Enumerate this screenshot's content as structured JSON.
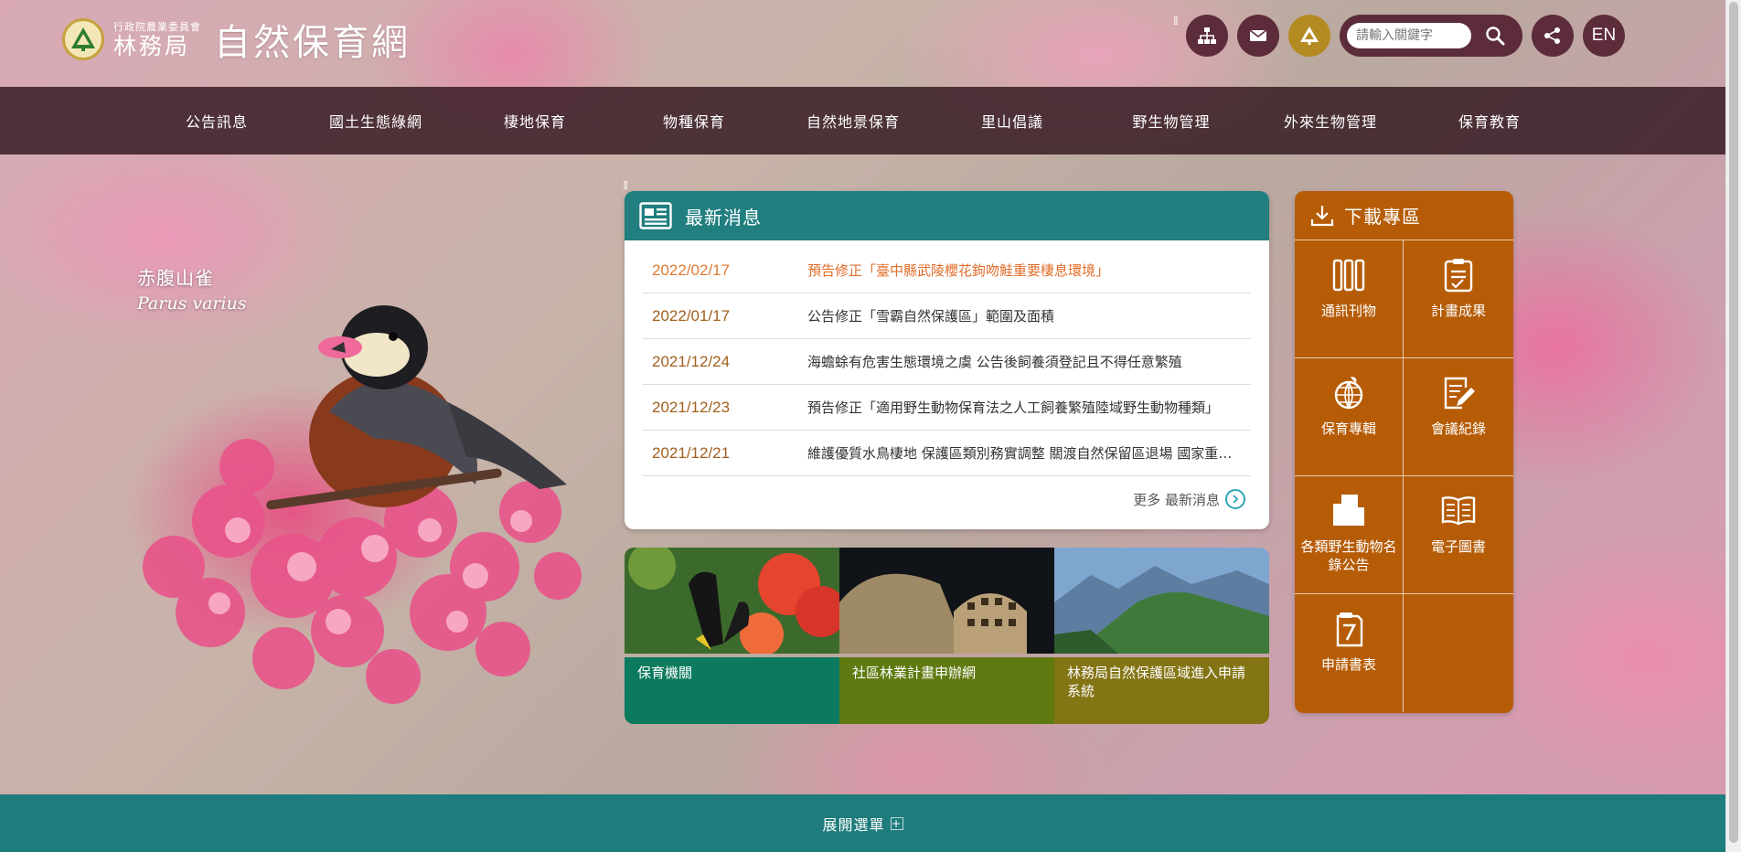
{
  "header": {
    "logo_sub": "行政院農業委員會",
    "logo_main": "林務局",
    "site_title": "自然保育網",
    "search_placeholder": "請輸入關鍵字",
    "lang_label": "EN",
    "tool_handle": "⁞⁞"
  },
  "nav": {
    "items": [
      "公告訊息",
      "國土生態綠網",
      "棲地保育",
      "物種保育",
      "自然地景保育",
      "里山倡議",
      "野生物管理",
      "外來生物管理",
      "保育教育"
    ]
  },
  "species": {
    "name_zh": "赤腹山雀",
    "name_latin": "Parus varius"
  },
  "news": {
    "title": "最新消息",
    "items": [
      {
        "date": "2022/02/17",
        "text": "預告修正「臺中縣武陵櫻花鉤吻鮭重要棲息環境」"
      },
      {
        "date": "2022/01/17",
        "text": "公告修正「雪霸自然保護區」範圍及面積"
      },
      {
        "date": "2021/12/24",
        "text": "海蟾蜍有危害生態環境之虞 公告後飼養須登記且不得任意繁殖"
      },
      {
        "date": "2021/12/23",
        "text": "預告修正「適用野生動物保育法之人工飼養繁殖陸域野生動物種類」"
      },
      {
        "date": "2021/12/21",
        "text": "維護優質水鳥棲地 保護區類別務實調整 關渡自然保留區退場 國家重要濕地"
      }
    ],
    "more_label": "更多 最新消息"
  },
  "tiles": [
    {
      "label": "保育機關"
    },
    {
      "label": "社區林業計畫申辦網"
    },
    {
      "label": "林務局自然保護區域進入申請系統"
    }
  ],
  "downloads": {
    "title": "下載專區",
    "items": [
      {
        "label": "通訊刊物",
        "icon": "books-icon"
      },
      {
        "label": "計畫成果",
        "icon": "clipboard-icon"
      },
      {
        "label": "保育專輯",
        "icon": "globe-icon"
      },
      {
        "label": "會議紀錄",
        "icon": "edit-document-icon"
      },
      {
        "label": "各類野生動物名錄公告",
        "icon": "folder-icon"
      },
      {
        "label": "電子圖書",
        "icon": "open-book-icon"
      },
      {
        "label": "申請書表",
        "icon": "form-icon"
      }
    ]
  },
  "footer": {
    "expand_label": "展開選單",
    "plus": "+"
  },
  "colors": {
    "nav_bg": "#32161e",
    "news_head": "#217f80",
    "download_bg": "#b65c06",
    "footer_bg": "#1f7c7c",
    "date_color": "#a15f1c",
    "active_news": "#e06d2a"
  }
}
